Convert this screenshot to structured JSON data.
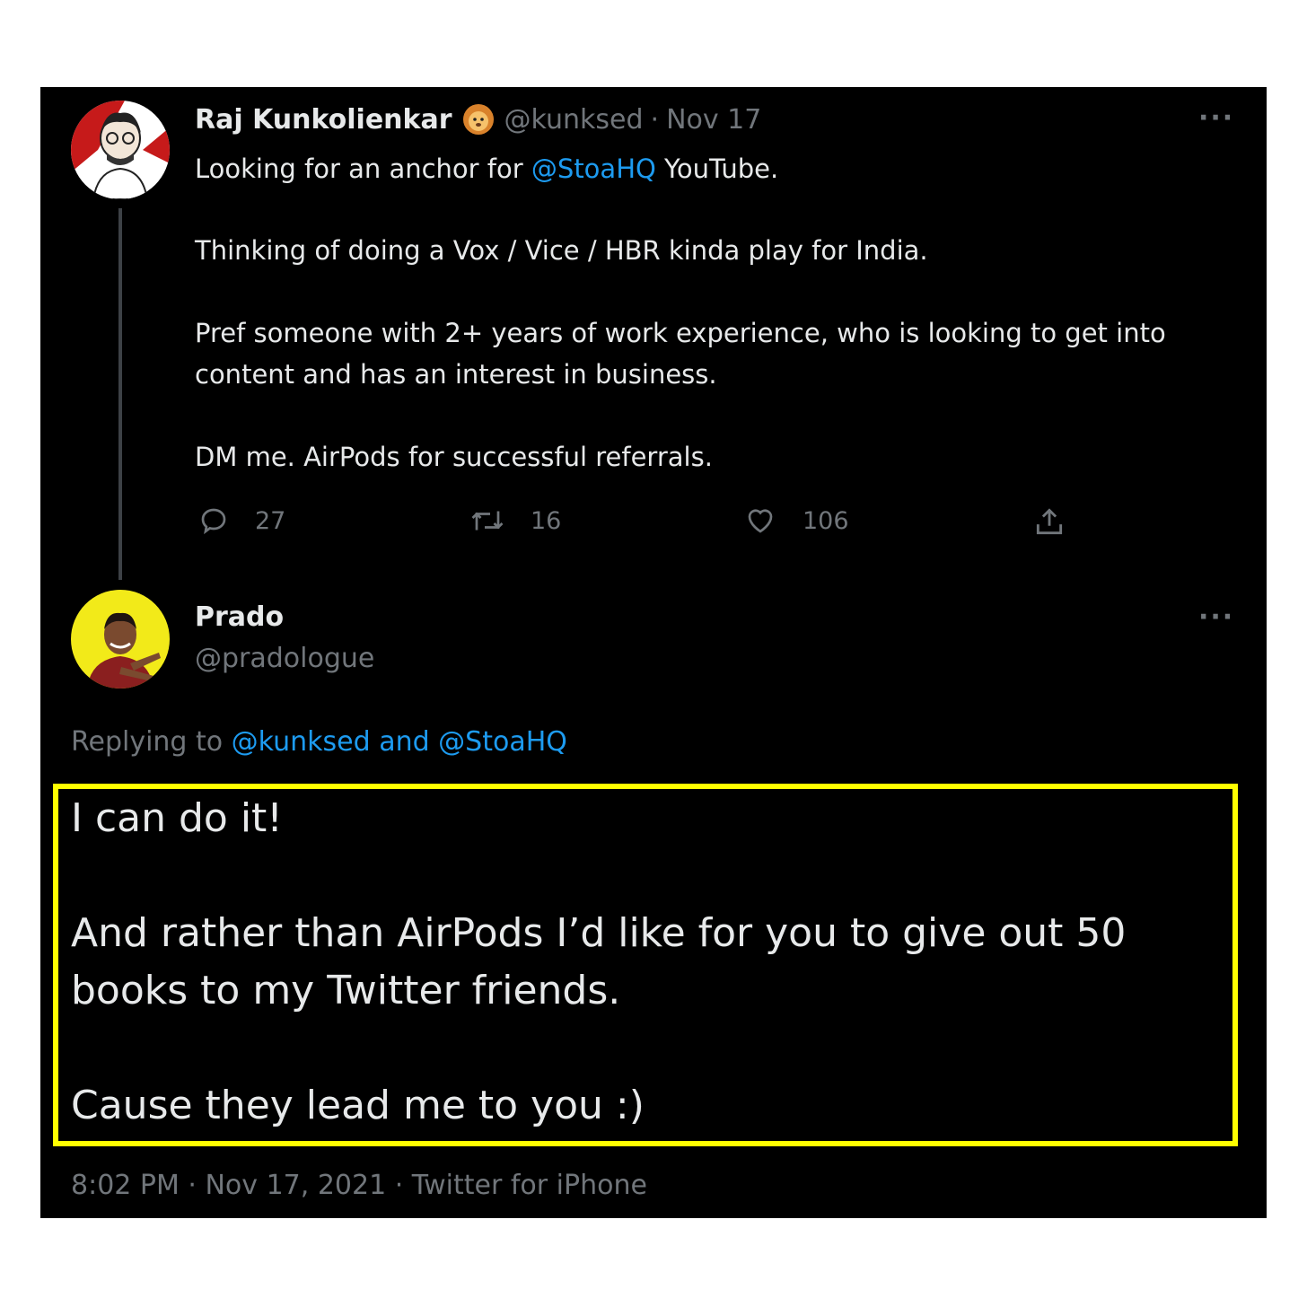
{
  "parent_tweet": {
    "author_name": "Raj Kunkolienkar",
    "badge_icon": "lion-emoji-icon",
    "handle": "@kunksed",
    "separator": "·",
    "date": "Nov 17",
    "more_label": "···",
    "text": {
      "line1_prefix": "Looking for an anchor for ",
      "line1_mention": "@StoaHQ",
      "line1_suffix": " YouTube.",
      "line2": "Thinking of doing a Vox / Vice / HBR kinda play for India.",
      "line3": "Pref someone with 2+ years of work experience, who is looking to get into",
      "line4": "content and has an interest in business.",
      "line5": "DM me. AirPods for successful referrals."
    },
    "actions": {
      "replies": "27",
      "retweets": "16",
      "likes": "106"
    }
  },
  "reply_tweet": {
    "author_name": "Prado",
    "handle": "@pradologue",
    "more_label": "···",
    "replying_prefix": "Replying to ",
    "replying_to": "@kunksed and @StoaHQ",
    "text": {
      "line1": "I can do it!",
      "line2": "And rather than AirPods I’d like for you to give out 50",
      "line3": "books to my Twitter friends.",
      "line4": "Cause they lead me to you :)"
    },
    "meta": "8:02 PM · Nov 17, 2021 · Twitter for iPhone"
  },
  "colors": {
    "background": "#000000",
    "text": "#e7e9ea",
    "muted": "#71767b",
    "link": "#1d9bf0",
    "highlight": "#ffff00"
  }
}
